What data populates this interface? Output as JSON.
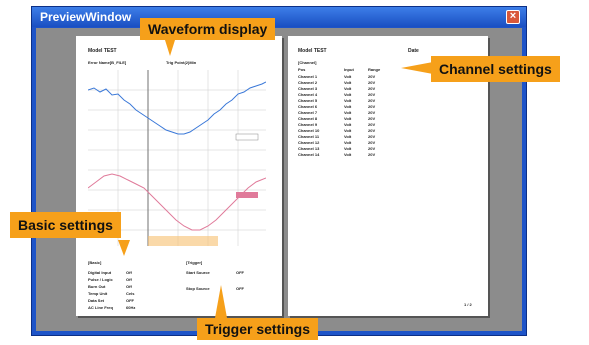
{
  "window": {
    "title": "PreviewWindow"
  },
  "page1": {
    "model": "Model TEST",
    "file": "Error Name[B_FILE]",
    "upper_text": "Trig Point(2)Min",
    "basic_header": "[Basic]",
    "basic_rows": [
      {
        "label": "Digital Input",
        "value": "Off"
      },
      {
        "label": "Pulse / Logic",
        "value": "Off"
      },
      {
        "label": "Burn Out",
        "value": "Off"
      },
      {
        "label": "Temp Unit",
        "value": "Cels"
      },
      {
        "label": "Data Set",
        "value": "OFF"
      },
      {
        "label": "AC Line Freq",
        "value": "60Hz"
      }
    ],
    "trigger_header": "[Trigger]",
    "trigger_rows": [
      {
        "label": "Start Source",
        "value": "OFF"
      },
      {
        "label": "Stop Source",
        "value": "OFF"
      }
    ]
  },
  "page2": {
    "model": "Model TEST",
    "date": "Date",
    "channel_header": "[Channel]",
    "columns": [
      "Pos",
      "Input",
      "Range"
    ],
    "channels": [
      [
        "Channel 1",
        "Volt",
        "20V"
      ],
      [
        "Channel 2",
        "Volt",
        "20V"
      ],
      [
        "Channel 3",
        "Volt",
        "20V"
      ],
      [
        "Channel 4",
        "Volt",
        "20V"
      ],
      [
        "Channel 5",
        "Volt",
        "20V"
      ],
      [
        "Channel 6",
        "Volt",
        "20V"
      ],
      [
        "Channel 7",
        "Volt",
        "20V"
      ],
      [
        "Channel 8",
        "Volt",
        "20V"
      ],
      [
        "Channel 9",
        "Volt",
        "20V"
      ],
      [
        "Channel 10",
        "Volt",
        "20V"
      ],
      [
        "Channel 11",
        "Volt",
        "20V"
      ],
      [
        "Channel 12",
        "Volt",
        "20V"
      ],
      [
        "Channel 13",
        "Volt",
        "20V"
      ],
      [
        "Channel 14",
        "Volt",
        "20V"
      ]
    ],
    "page_number": "1 / 2"
  },
  "callouts": {
    "waveform": "Waveform display",
    "channel": "Channel settings",
    "basic": "Basic settings",
    "trigger": "Trigger settings"
  },
  "colors": {
    "titlebar": "#1e54c8",
    "callout": "#f6a01a",
    "wave_blue": "#3a78d8",
    "wave_pink": "#e07a9a"
  }
}
